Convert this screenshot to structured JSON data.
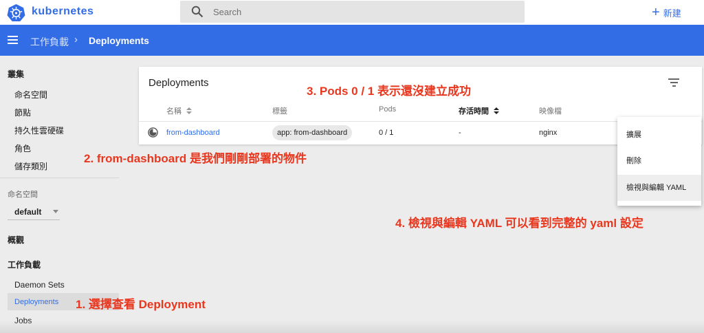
{
  "app": {
    "brand": "kubernetes",
    "search_placeholder": "Search",
    "create_label": "新建"
  },
  "header": {
    "breadcrumb_parent": "工作負載",
    "breadcrumb_current": "Deployments"
  },
  "sidebar": {
    "cluster_heading": "叢集",
    "cluster_items": [
      "命名空間",
      "節點",
      "持久性雲硬碟",
      "角色",
      "儲存類別"
    ],
    "namespace_label": "命名空間",
    "namespace_value": "default",
    "overview": "概觀",
    "workloads_heading": "工作負載",
    "workload_items": [
      "Daemon Sets",
      "Deployments",
      "Jobs"
    ],
    "active_item": "Deployments"
  },
  "card": {
    "title": "Deployments",
    "columns": [
      "名稱",
      "標籤",
      "Pods",
      "存活時間",
      "映像檔"
    ],
    "rows": [
      {
        "name": "from-dashboard",
        "label": "app: from-dashboard",
        "pods": "0 / 1",
        "age": "-",
        "image": "nginx"
      }
    ]
  },
  "context_menu": {
    "items": [
      "擴展",
      "刪除",
      "檢視與編輯 YAML"
    ]
  },
  "annotations": {
    "step1": "1. 選擇查看 Deployment",
    "step2": "2. from-dashboard 是我們剛剛部署的物件",
    "step3": "3. Pods 0 / 1 表示還沒建立成功",
    "step4": "4. 檢視與編輯 YAML 可以看到完整的 yaml 設定"
  },
  "colors": {
    "brand_blue": "#326de6",
    "annotation_red": "#e8371e"
  }
}
